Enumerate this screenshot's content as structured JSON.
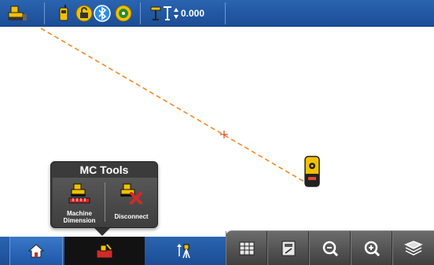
{
  "status_bar": {
    "elevation_readout": "0.000",
    "icons": [
      "machine-icon",
      "radio-icon",
      "lock-icon",
      "bluetooth-icon",
      "gps-status-icon",
      "benchmark-icon",
      "elevation-icon",
      "up-down-arrow-icon"
    ]
  },
  "map": {
    "line_color": "#f08a24",
    "target_marker_color": "#e04a2a",
    "device_color": "#f2c100"
  },
  "popup": {
    "title": "MC Tools",
    "items": [
      {
        "label_line1": "Machine",
        "label_line2": "Dimension",
        "icon": "machine-dimension-icon"
      },
      {
        "label_line1": "Disconnect",
        "label_line2": "",
        "icon": "disconnect-icon"
      }
    ]
  },
  "bottom_bar": {
    "tabs": [
      "home-icon",
      "mc-tools-icon",
      "survey-icon"
    ],
    "tools": [
      "grid-view-icon",
      "calculator-icon",
      "zoom-out-icon",
      "zoom-in-icon",
      "layers-icon"
    ]
  },
  "colors": {
    "brand_blue": "#1f55a0",
    "toolbar_gray": "#555555",
    "accent_yellow": "#f2c100",
    "accent_red": "#d02a2a"
  }
}
